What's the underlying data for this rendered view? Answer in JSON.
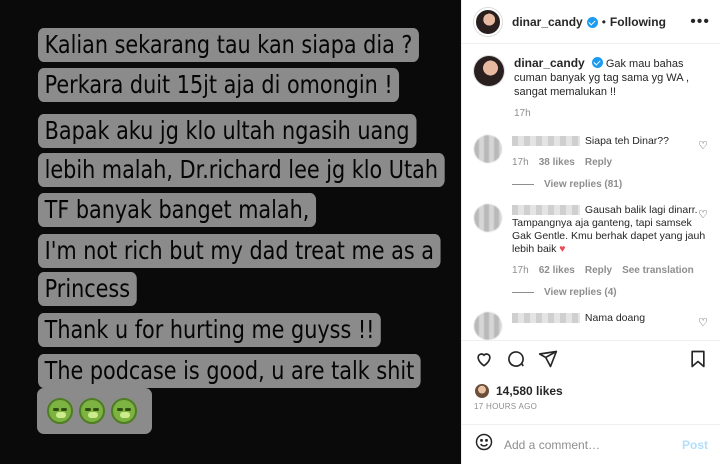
{
  "post": {
    "lines": [
      "Kalian sekarang tau kan siapa dia ?",
      "Perkara duit 15jt aja di omongin !",
      "Bapak aku jg klo ultah ngasih uang",
      "lebih malah, Dr.richard lee jg klo Utah",
      "TF banyak banget malah,",
      "I'm not rich but my dad treat me as a",
      "Princess",
      "Thank u for hurting me guyss !!",
      "The podcase is good, u are talk shit"
    ],
    "emoji_icon": "nauseated-face-emoji"
  },
  "header": {
    "username": "dinar_candy",
    "separator": "•",
    "follow_state": "Following",
    "more_icon": "more-horizontal-icon"
  },
  "caption": {
    "username": "dinar_candy",
    "text": "Gak mau bahas cuman banyak yg tag sama yg WA , sangat memalukan !!",
    "time": "17h"
  },
  "comments": [
    {
      "text": "Siapa teh Dinar??",
      "time": "17h",
      "likes": "38 likes",
      "reply": "Reply",
      "view_replies": "View replies (81)"
    },
    {
      "text": "Gausah balik lagi dinarr. Tampangnya aja ganteng, tapi samsek Gak Gentle. Kmu berhak dapet yang jauh lebih baik",
      "time": "17h",
      "likes": "62 likes",
      "reply": "Reply",
      "translation": "See translation",
      "view_replies": "View replies (4)"
    },
    {
      "text": "Nama doang"
    }
  ],
  "footer": {
    "likes": "14,580 likes",
    "time_ago": "17 HOURS AGO",
    "comment_placeholder": "Add a comment…",
    "post_label": "Post"
  },
  "colors": {
    "verified": "#1d9bf0",
    "post_button": "#b2dffc",
    "muted": "#8e8e8e",
    "story_bg": "#8b8b8b"
  }
}
